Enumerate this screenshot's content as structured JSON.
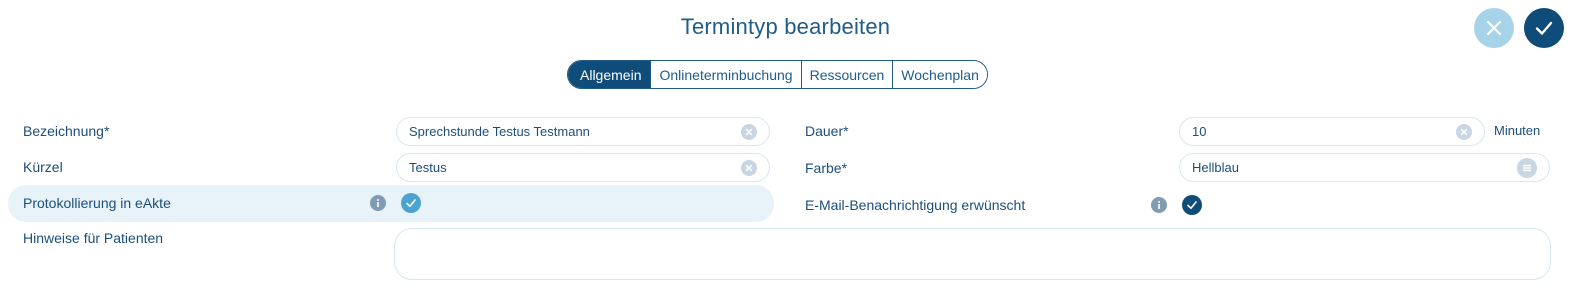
{
  "dialog": {
    "title": "Termintyp bearbeiten"
  },
  "tabs": [
    {
      "label": "Allgemein",
      "active": true
    },
    {
      "label": "Onlineterminbuchung",
      "active": false
    },
    {
      "label": "Ressourcen",
      "active": false
    },
    {
      "label": "Wochenplan",
      "active": false
    }
  ],
  "form": {
    "bezeichnung": {
      "label": "Bezeichnung*",
      "value": "Sprechstunde Testus Testmann"
    },
    "kuerzel": {
      "label": "Kürzel",
      "value": "Testus"
    },
    "protokollierung": {
      "label": "Protokollierung in eAkte",
      "checked": true
    },
    "hinweise": {
      "label": "Hinweise für Patienten",
      "value": ""
    },
    "dauer": {
      "label": "Dauer*",
      "value": "10",
      "unit": "Minuten"
    },
    "farbe": {
      "label": "Farbe*",
      "value": "Hellblau"
    },
    "email": {
      "label": "E-Mail-Benachrichtigung erwünscht",
      "checked": true
    }
  },
  "colors": {
    "primary": "#0f4c7a",
    "cancel": "#a7d3e8",
    "highlight_row": "#e8f2f9",
    "check_light": "#4ca3d0"
  }
}
